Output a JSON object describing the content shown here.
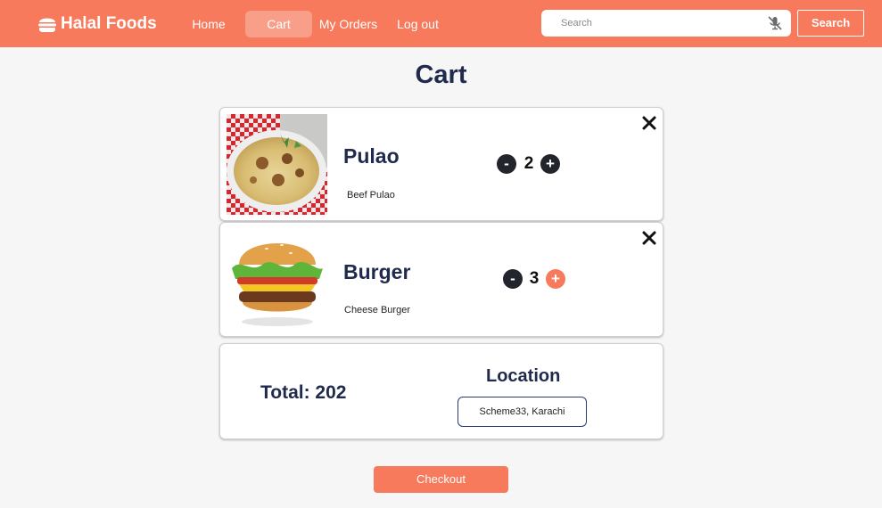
{
  "navbar": {
    "brand": "Halal Foods",
    "brand_icon": "burger-icon",
    "links": [
      {
        "label": "Home",
        "active": false
      },
      {
        "label": "Cart",
        "active": true
      },
      {
        "label": "My Orders",
        "active": false
      },
      {
        "label": "Log out",
        "active": false
      }
    ],
    "search": {
      "placeholder": "Search",
      "value": "",
      "mic_icon": "mic-muted-icon"
    },
    "search_button": "Search"
  },
  "page": {
    "title": "Cart"
  },
  "cart": {
    "items": [
      {
        "name": "Pulao",
        "description": "Beef Pulao",
        "quantity": "2",
        "minus_label": "-",
        "plus_label": "+",
        "image": "pulao-photo",
        "remove_icon": "close-icon"
      },
      {
        "name": "Burger",
        "description": "Cheese Burger",
        "quantity": "3",
        "minus_label": "-",
        "plus_label": "+",
        "image": "burger-photo",
        "remove_icon": "close-icon"
      }
    ],
    "total_label": "Total: 202",
    "location_title": "Location",
    "location_value": "Scheme33, Karachi",
    "checkout_label": "Checkout"
  },
  "colors": {
    "primary": "#f77a5c",
    "navy": "#1f2a4d",
    "dark_button": "#22262c",
    "background": "#f6f6f6"
  }
}
